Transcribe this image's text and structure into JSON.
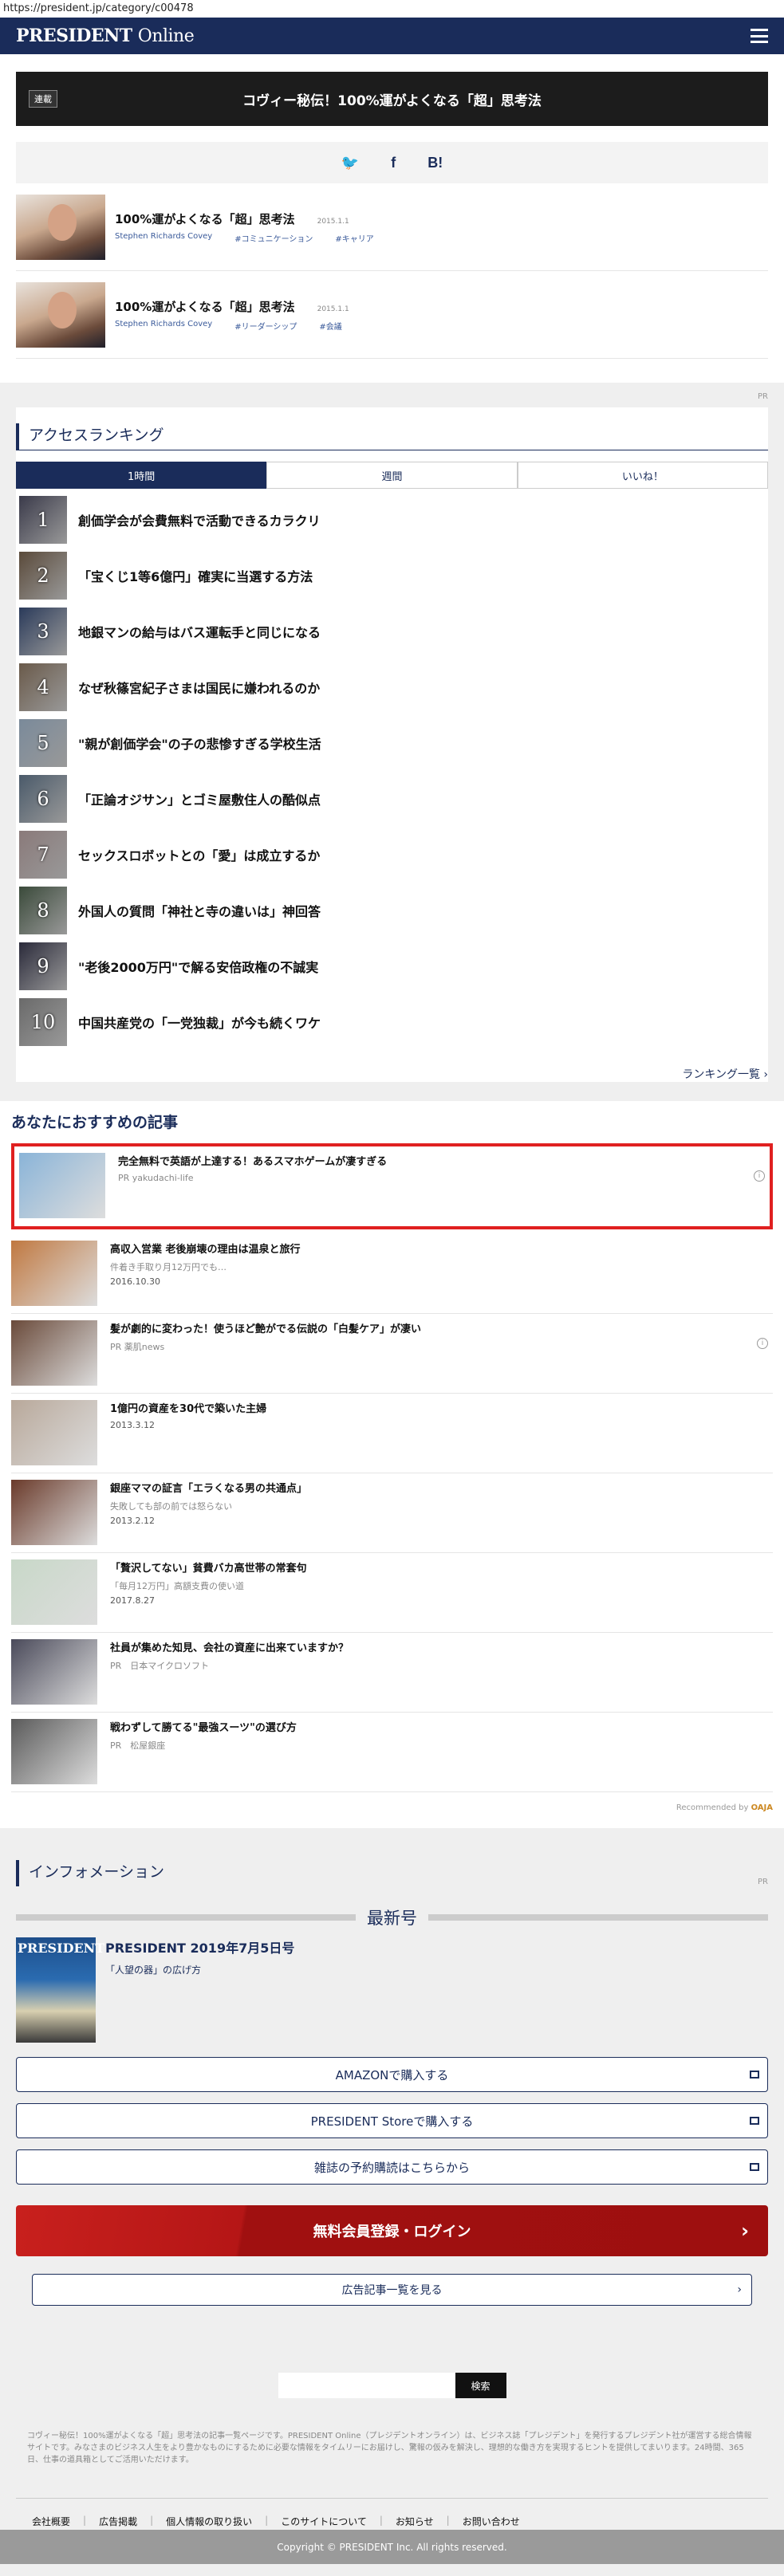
{
  "url": "https://president.jp/category/c00478",
  "header": {
    "logo_main": "PRESIDENT",
    "logo_online": "Online"
  },
  "series": {
    "badge": "連載",
    "title": "コヴィー秘伝！100%運がよくなる「超」思考法",
    "share": [
      "Twitter",
      "f",
      "B!"
    ],
    "share_icons": [
      "twitter-icon",
      "facebook-icon",
      "hatena-icon"
    ],
    "items": [
      {
        "title": "100%運がよくなる「超」思考法",
        "date": "2015.1.1",
        "author": "Stephen Richards Covey",
        "tags": [
          "#コミュニケーション",
          "#キャリア"
        ]
      },
      {
        "title": "100%運がよくなる「超」思考法",
        "date": "2015.1.1",
        "author": "Stephen Richards Covey",
        "tags": [
          "#リーダーシップ",
          "#会議"
        ]
      }
    ]
  },
  "pr_label": "PR",
  "ranking": {
    "title": "アクセスランキング",
    "tabs": [
      "1時間",
      "週間",
      "いいね！"
    ],
    "active_tab": 0,
    "items": [
      {
        "num": "1",
        "title": "創価学会が会費無料で活動できるカラクリ"
      },
      {
        "num": "2",
        "title": "「宝くじ1等6億円」確実に当選する方法"
      },
      {
        "num": "3",
        "title": "地銀マンの給与はバス運転手と同じになる"
      },
      {
        "num": "4",
        "title": "なぜ秋篠宮紀子さまは国民に嫌われるのか"
      },
      {
        "num": "5",
        "title": "\"親が創価学会\"の子の悲惨すぎる学校生活"
      },
      {
        "num": "6",
        "title": "「正論オジサン」とゴミ屋敷住人の酷似点"
      },
      {
        "num": "7",
        "title": "セックスロボットとの「愛」は成立するか"
      },
      {
        "num": "8",
        "title": "外国人の質問「神社と寺の違いは」神回答"
      },
      {
        "num": "9",
        "title": "\"老後2000万円\"で解る安倍政権の不誠実"
      },
      {
        "num": "10",
        "title": "中国共産党の「一党独裁」が今も続くワケ"
      }
    ],
    "more": "ランキング一覧 ›"
  },
  "recommend": {
    "heading": "あなたにおすすめの記事",
    "items": [
      {
        "title": "完全無料で英語が上達する！あるスマホゲームが凄すぎる",
        "sub": "PR yakudachi-life",
        "date": "",
        "featured": true,
        "info": true
      },
      {
        "title": "高収入営業 老後崩壊の理由は温泉と旅行",
        "sub": "件着き手取り月12万円でも…",
        "date": "2016.10.30",
        "featured": false,
        "info": false
      },
      {
        "title": "髪が劇的に変わった！使うほど艶がでる伝説の「白髪ケア」が凄い",
        "sub": "PR 薬肌news",
        "date": "",
        "featured": false,
        "info": true
      },
      {
        "title": "1億円の資産を30代で築いた主婦",
        "sub": "",
        "date": "2013.3.12",
        "featured": false,
        "info": false
      },
      {
        "title": "銀座ママの証言「エラくなる男の共通点」",
        "sub": "失敗しても部の前では怒らない",
        "date": "2013.2.12",
        "featured": false,
        "info": false
      },
      {
        "title": "「贅沢してない」貧費バカ高世帯の常套句",
        "sub": "「毎月12万円」高額支費の使い道",
        "date": "2017.8.27",
        "featured": false,
        "info": false
      },
      {
        "title": "社員が集めた知見、会社の資産に出来ていますか？",
        "sub": "PR　日本マイクロソフト",
        "date": "",
        "featured": false,
        "info": false
      },
      {
        "title": "戦わずして勝てる\"最強スーツ\"の選び方",
        "sub": "PR　松屋銀座",
        "date": "",
        "featured": false,
        "info": false
      }
    ],
    "recommended_by": "Recommended by",
    "recommended_brand": "OAJA"
  },
  "information": {
    "title": "インフォメーション",
    "latest_label": "最新号",
    "magazine_cover_text": "PRESIDENT",
    "magazine_title": "PRESIDENT 2019年7月5日号",
    "magazine_sub": "「人望の器」の広げ方",
    "buttons": [
      "AMAZONで購入する",
      "PRESIDENT Storeで購入する",
      "雑誌の予約購読はこちらから"
    ],
    "login": "無料会員登録・ログイン",
    "ad_list": "広告記事一覧を見る"
  },
  "search": {
    "button": "検索",
    "placeholder": ""
  },
  "description": "コヴィー秘伝！100%運がよくなる「超」思考法の記事一覧ページです。PRESIDENT Online（プレジデントオンライン）は、ビジネス誌「プレジデント」を発行するプレジデント社が運営する総合情報サイトです。みなさまのビジネス人生をより豊かなものにするために必要な情報をタイムリーにお届けし、驚報の仮みを解決し、理想的な働き方を実現するヒントを提供してまいります。24時間、365日、仕事の道具箱としてご活用いただけます。",
  "footer": {
    "links": [
      "会社概要",
      "広告掲載",
      "個人情報の取り扱い",
      "このサイトについて",
      "お知らせ",
      "お問い合わせ"
    ],
    "copyright": "Copyright © PRESIDENT Inc. All rights reserved."
  },
  "colors": {
    "navy": "#1a2c5a",
    "red": "#b51616",
    "highlight": "#e02020"
  }
}
